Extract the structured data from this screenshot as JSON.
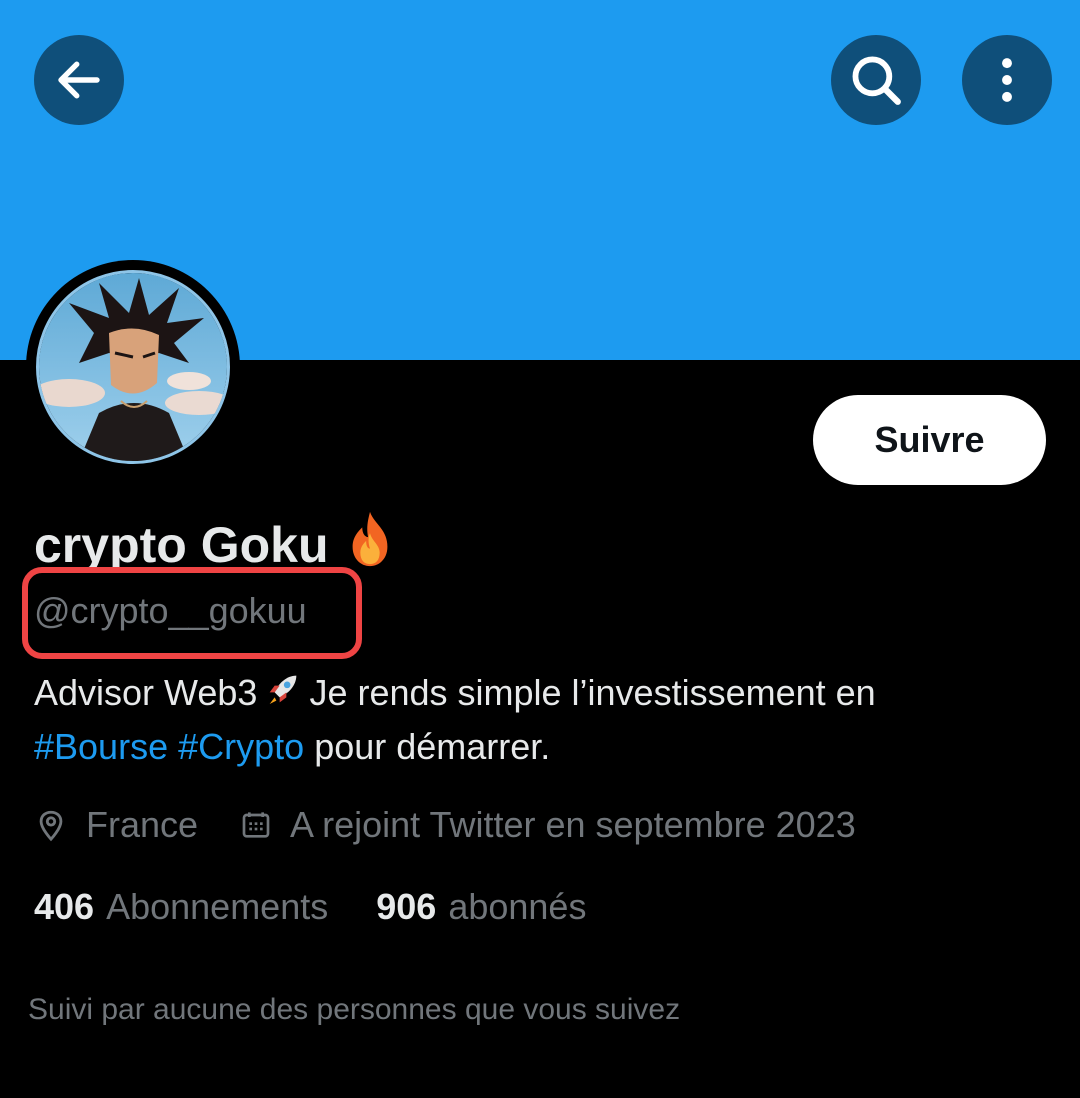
{
  "header": {
    "back_icon": "arrow-left-icon",
    "search_icon": "search-icon",
    "more_icon": "more-vertical-icon"
  },
  "profile": {
    "display_name": "crypto Goku",
    "name_emoji": "flame-emoji",
    "handle": "@crypto__gokuu",
    "follow_label": "Suivre",
    "bio": {
      "part1": "Advisor Web3",
      "part2": "Je rends simple l’investissement en",
      "hashtag1": "#Bourse",
      "hashtag2": "#Crypto",
      "part3": "pour démarrer."
    },
    "location": "France",
    "joined": "A rejoint Twitter en septembre 2023",
    "following_count": "406",
    "following_label": "Abonnements",
    "followers_count": "906",
    "followers_label": "abonnés",
    "followed_by_text": "Suivi par aucune des personnes que vous suivez"
  },
  "colors": {
    "banner": "#1d9bf0",
    "header_button_bg": "#0f4f7a",
    "accent_link": "#1d9bf0",
    "highlight_box": "#ef4444",
    "secondary_text": "#71767b",
    "primary_text": "#e7e9ea",
    "background": "#000000"
  }
}
